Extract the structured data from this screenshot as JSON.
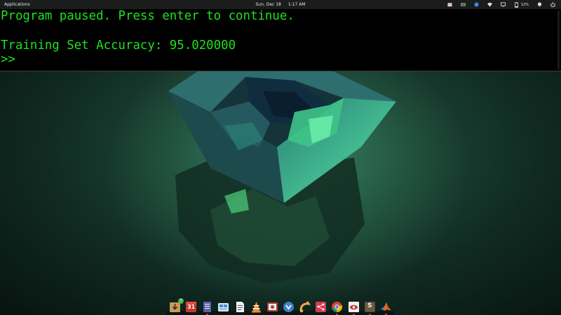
{
  "top_panel": {
    "applications_label": "Applications",
    "date": "Sun, Dec 18",
    "time": "1:17 AM",
    "battery_percent": "12%",
    "tray_icons": [
      "cat-icon",
      "monitor-icon",
      "network-blue-icon",
      "wifi-icon",
      "display-icon",
      "battery-icon",
      "notification-bell-icon",
      "power-icon"
    ]
  },
  "terminal": {
    "line1": "Program paused. Press enter to continue.",
    "line2": "Training Set Accuracy: 95.020000",
    "prompt": ">>",
    "text_color": "#1ee21e",
    "background": "#000000"
  },
  "dock": {
    "items": [
      {
        "name": "downloads-icon",
        "badge": "7",
        "running": false
      },
      {
        "name": "calendar-icon",
        "label": "31",
        "running": false
      },
      {
        "name": "text-editor-icon",
        "running": true
      },
      {
        "name": "appstore-icon",
        "running": false
      },
      {
        "name": "document-viewer-icon",
        "running": false
      },
      {
        "name": "vlc-icon",
        "running": false
      },
      {
        "name": "screenshot-icon",
        "running": false
      },
      {
        "name": "bittorrent-icon",
        "running": false
      },
      {
        "name": "share-icon",
        "running": false
      },
      {
        "name": "chrome-icon",
        "running": true
      },
      {
        "name": "eye-of-gnome-icon",
        "running": true
      },
      {
        "name": "sublime-text-icon",
        "label": "S",
        "running": true
      },
      {
        "name": "matlab-icon",
        "running": true
      }
    ]
  },
  "colors": {
    "panel": "#1b1d1c",
    "wallpaper_accent": "#3fd98a"
  }
}
